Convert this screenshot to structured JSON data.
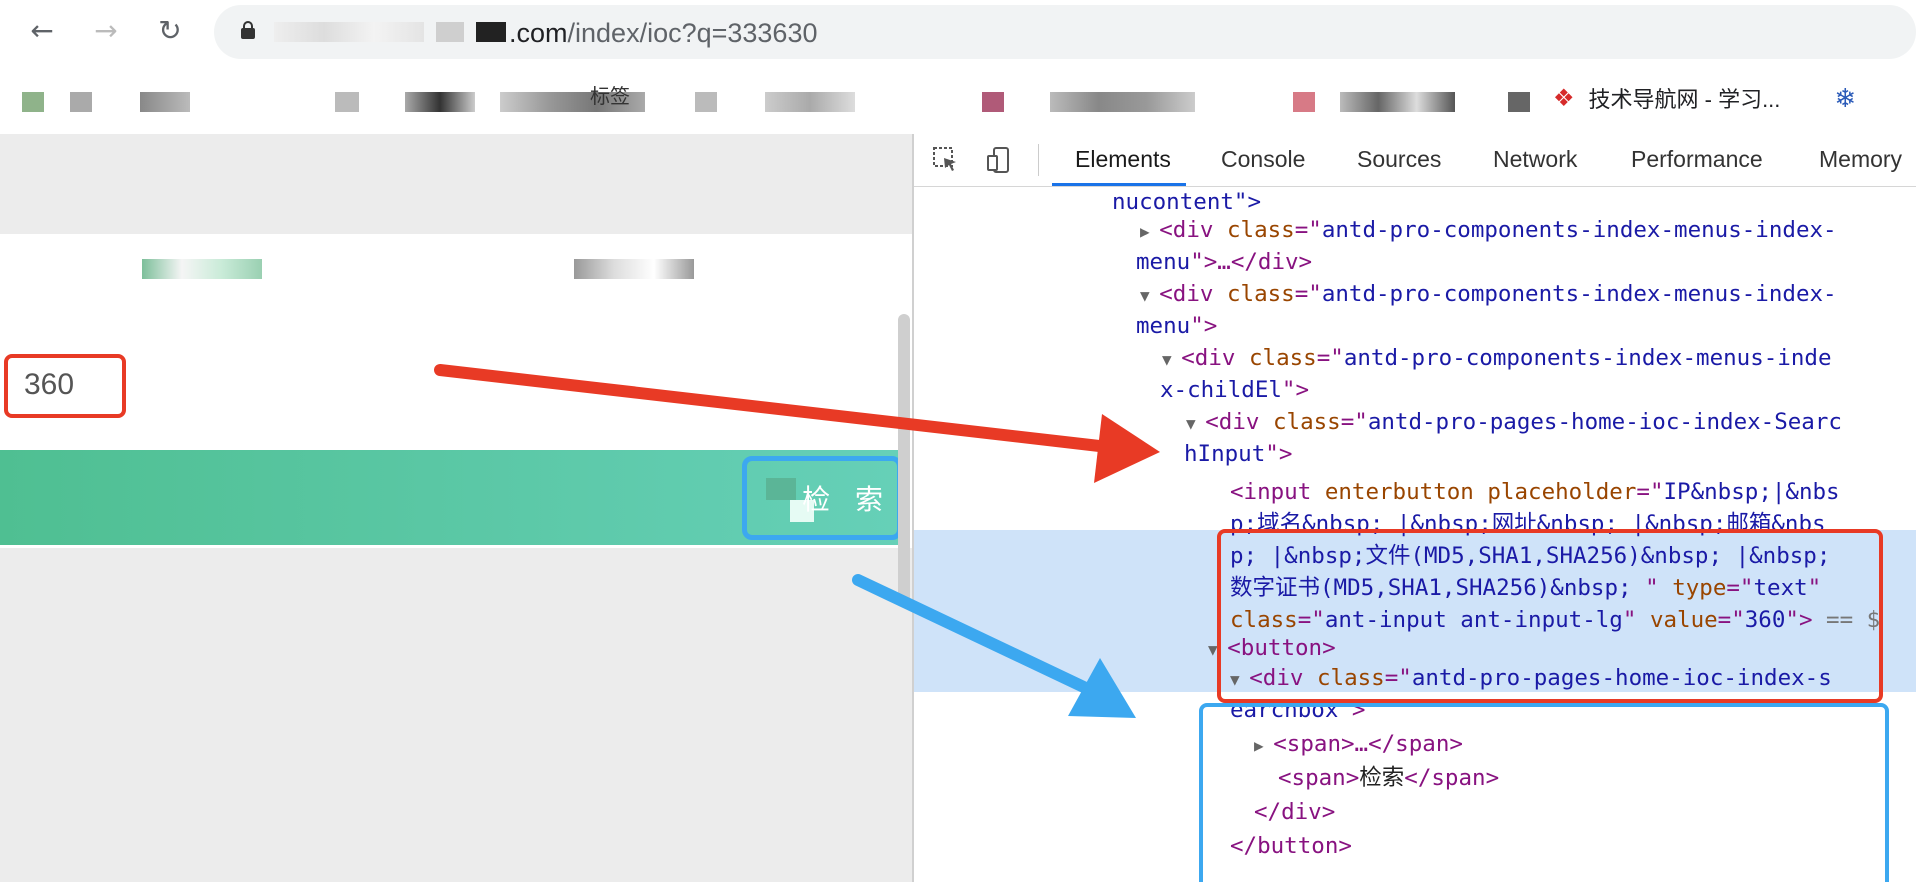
{
  "browser": {
    "url_domain": ".com",
    "url_path": "/index/ioc?q=333630"
  },
  "bookmarks": {
    "partial_label": "标签",
    "tech_nav": "技术导航网 - 学习..."
  },
  "page": {
    "search_value": "360",
    "search_button": "检 索"
  },
  "devtools": {
    "tabs": [
      "Elements",
      "Console",
      "Sources",
      "Network",
      "Performance",
      "Memory"
    ],
    "lines": {
      "l0": "nucontent\">",
      "l1a": "<div ",
      "l1b": "class",
      "l1c": "=\"",
      "l1d": "antd-pro-components-index-menus-index-",
      "l1e": "menu",
      "l1f": "\">…</div>",
      "l3d": "antd-pro-components-index-menus-index-",
      "l3e": "menu",
      "l3f": "\">",
      "l5d": "antd-pro-components-index-menus-inde",
      "l5e": "x-childEl",
      "l5f": "\">",
      "l7d": "antd-pro-pages-home-ioc-index-Searc",
      "l7e": "hInput",
      "l7f": "\">",
      "in1": "<input ",
      "in1b": "enterbutton ",
      "in1c": "placeholder",
      "in1d": "=\"",
      "in1e": "IP&nbsp;|&nbs",
      "in2": "p;域名&nbsp; |&nbsp;网址&nbsp; |&nbsp;邮箱&nbs",
      "in3": "p; |&nbsp;文件(MD5,SHA1,SHA256)&nbsp; |&nbsp;",
      "in4a": "数字证书(MD5,SHA1,SHA256)&nbsp; ",
      "in4b": "\" ",
      "in4c": "type",
      "in4d": "=\"",
      "in4e": "text",
      "in4f": "\"",
      "in5a": "class",
      "in5b": "=\"",
      "in5c": "ant-input ant-input-lg",
      "in5d": "\" ",
      "in5e": "value",
      "in5f": "=\"",
      "in5g": "360",
      "in5h": "\">",
      "in5i": " == $",
      "btn": "<button>",
      "sb1d": "antd-pro-pages-home-ioc-index-s",
      "sb2": "earchbox",
      "sb2f": "\">",
      "span1": "<span>…</span>",
      "span2a": "<span>",
      "span2b": "检索",
      "span2c": "</span>",
      "divclose": "</div>",
      "btnclose": "</button>"
    }
  },
  "colors": {
    "red_annotation": "#e83a25",
    "blue_annotation": "#3ca8f0",
    "search_bar_green": "#55c49c"
  }
}
